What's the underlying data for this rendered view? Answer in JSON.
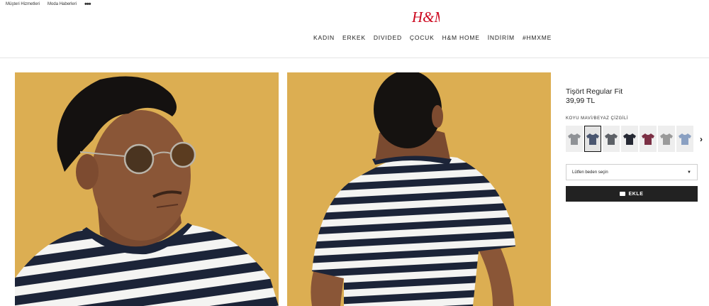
{
  "header": {
    "utility_links": [
      "Müşteri Hizmetleri",
      "Moda Haberleri"
    ],
    "more_label": "•••",
    "logo_text": "H&M",
    "nav": [
      "KADIN",
      "ERKEK",
      "DIVIDED",
      "ÇOCUK",
      "H&M HOME",
      "İNDİRİM",
      "#HMXME"
    ]
  },
  "product": {
    "name": "Tişört Regular Fit",
    "price": "39,99 TL",
    "color_name": "KOYU MAVİ/BEYAZ ÇİZGİLİ",
    "swatches": [
      {
        "color": "#8f9296",
        "selected": false
      },
      {
        "color": "#4a5670",
        "selected": true
      },
      {
        "color": "#5d6167",
        "selected": false
      },
      {
        "color": "#252833",
        "selected": false
      },
      {
        "color": "#7b2f44",
        "selected": false
      },
      {
        "color": "#9a9a9a",
        "selected": false
      },
      {
        "color": "#8aa0c2",
        "selected": false
      }
    ],
    "size_placeholder": "Lütfen beden seçin",
    "add_label": "EKLE"
  },
  "colors": {
    "background_mustard": "#dcae52",
    "brand_red": "#cc071e",
    "button_dark": "#222222"
  }
}
